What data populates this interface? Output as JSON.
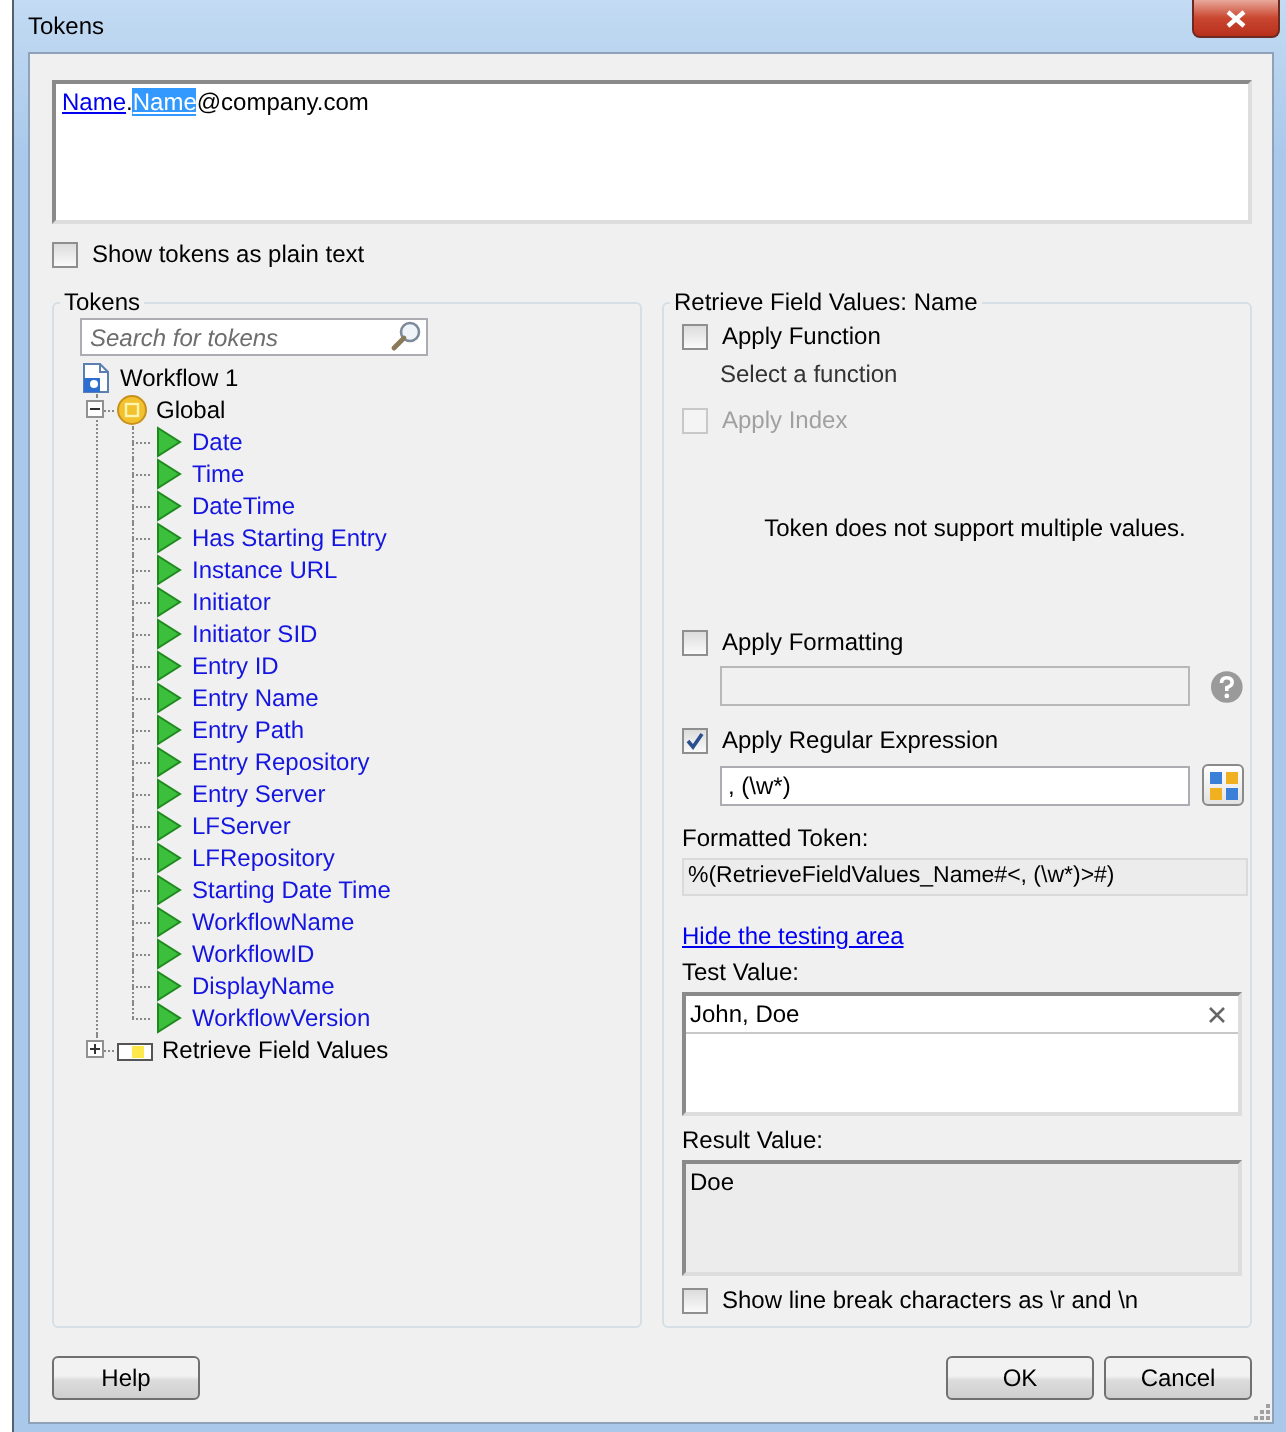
{
  "window": {
    "title": "Tokens"
  },
  "editor": {
    "segments": [
      {
        "text": "Name",
        "kind": "token",
        "selected": false
      },
      {
        "text": ".",
        "kind": "plain",
        "selected": false
      },
      {
        "text": "Name",
        "kind": "token",
        "selected": true
      },
      {
        "text": "@company.com",
        "kind": "plain",
        "selected": false
      }
    ]
  },
  "show_plain_text": {
    "label": "Show tokens as plain text",
    "checked": false
  },
  "tokens_panel": {
    "title": "Tokens",
    "search": {
      "placeholder": "Search for tokens"
    },
    "tree": [
      {
        "label": "Workflow 1",
        "kind": "workflow",
        "children": [
          {
            "label": "Global",
            "kind": "global",
            "expanded": true,
            "children": [
              {
                "label": "Date",
                "kind": "token"
              },
              {
                "label": "Time",
                "kind": "token"
              },
              {
                "label": "DateTime",
                "kind": "token"
              },
              {
                "label": "Has Starting Entry",
                "kind": "token"
              },
              {
                "label": "Instance URL",
                "kind": "token"
              },
              {
                "label": "Initiator",
                "kind": "token"
              },
              {
                "label": "Initiator SID",
                "kind": "token"
              },
              {
                "label": "Entry ID",
                "kind": "token"
              },
              {
                "label": "Entry Name",
                "kind": "token"
              },
              {
                "label": "Entry Path",
                "kind": "token"
              },
              {
                "label": "Entry Repository",
                "kind": "token"
              },
              {
                "label": "Entry Server",
                "kind": "token"
              },
              {
                "label": "LFServer",
                "kind": "token"
              },
              {
                "label": "LFRepository",
                "kind": "token"
              },
              {
                "label": "Starting Date Time",
                "kind": "token"
              },
              {
                "label": "WorkflowName",
                "kind": "token"
              },
              {
                "label": "WorkflowID",
                "kind": "token"
              },
              {
                "label": "DisplayName",
                "kind": "token"
              },
              {
                "label": "WorkflowVersion",
                "kind": "token"
              }
            ]
          },
          {
            "label": "Retrieve Field Values",
            "kind": "field_group",
            "expanded": false
          }
        ]
      }
    ]
  },
  "retrieve_panel": {
    "title": "Retrieve Field Values: Name",
    "apply_function": {
      "label": "Apply Function",
      "checked": false
    },
    "function_hint": "Select a function",
    "apply_index": {
      "label": "Apply Index",
      "checked": false,
      "disabled": true
    },
    "message": "Token does not support multiple values.",
    "apply_formatting": {
      "label": "Apply Formatting",
      "checked": false
    },
    "formatting_field": {
      "disabled": true
    },
    "apply_regex": {
      "label": "Apply Regular Expression",
      "checked": true
    },
    "regex_field": {
      "value": ", (\\w*)"
    },
    "formatted_label": "Formatted Token:",
    "formatted_value": "%(RetrieveFieldValues_Name#<, (\\w*)>#)",
    "toggle_link": "Hide the testing area",
    "test_label": "Test Value:",
    "test_value": "John, Doe",
    "result_label": "Result Value:",
    "result_value": "Doe",
    "show_line_breaks": {
      "label": "Show line break characters as \\r and \\n",
      "checked": false
    }
  },
  "buttons_left": [
    "Help"
  ],
  "buttons_right": [
    "OK",
    "Cancel"
  ]
}
